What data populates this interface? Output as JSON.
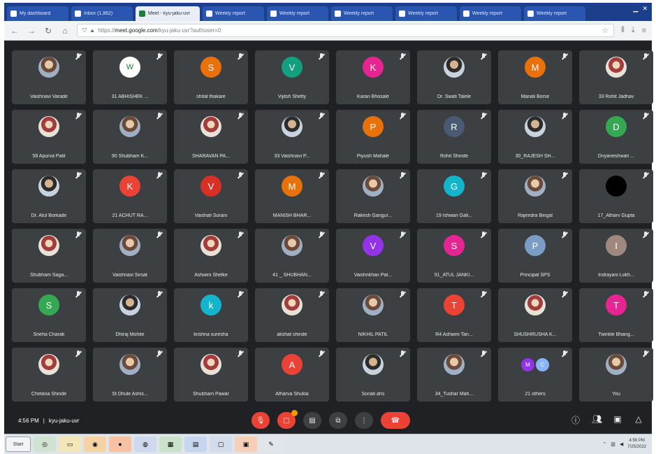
{
  "browser": {
    "tabs": [
      {
        "label": "My dashboard",
        "active": false
      },
      {
        "label": "Inbox (1,862)",
        "active": false
      },
      {
        "label": "Meet - kyu-jaku-uvr",
        "active": true
      },
      {
        "label": "Weekly report",
        "active": false
      },
      {
        "label": "Weekly report",
        "active": false
      },
      {
        "label": "Weekly report",
        "active": false
      },
      {
        "label": "Weekly report",
        "active": false
      },
      {
        "label": "Weekly report",
        "active": false
      },
      {
        "label": "Weekly report",
        "active": false
      }
    ],
    "url_domain": "meet.google.com",
    "url_rest": "/kyu-jaku-uvr?authuser=0",
    "url_prefix": "https://"
  },
  "participants": [
    {
      "name": "Vaishnavi Varade",
      "initial": "",
      "color": "",
      "kind": "photo"
    },
    {
      "name": "31 ABHISHEK ...",
      "initial": "W",
      "color": "#ffffff",
      "kind": "logo"
    },
    {
      "name": "shital thakare",
      "initial": "S",
      "color": "#e8710a",
      "kind": "initial"
    },
    {
      "name": "Vijitsh Shetty",
      "initial": "V",
      "color": "#12a07f",
      "kind": "initial"
    },
    {
      "name": "Karan Bhosale",
      "initial": "K",
      "color": "#e52592",
      "kind": "initial"
    },
    {
      "name": "Dr. Swati Talele",
      "initial": "",
      "color": "",
      "kind": "photo2"
    },
    {
      "name": "Manali Borse",
      "initial": "M",
      "color": "#e8710a",
      "kind": "initial"
    },
    {
      "name": "33 Rohit Jadhav",
      "initial": "",
      "color": "",
      "kind": "photo3"
    },
    {
      "name": "58 Apurva Patil",
      "initial": "",
      "color": "",
      "kind": "photo3"
    },
    {
      "name": "90 Shubham K...",
      "initial": "",
      "color": "",
      "kind": "photo"
    },
    {
      "name": "SHARAVAN PA...",
      "initial": "",
      "color": "",
      "kind": "photo3"
    },
    {
      "name": "33 Vaishnavi P...",
      "initial": "",
      "color": "",
      "kind": "photo2"
    },
    {
      "name": "Piyush Mahale",
      "initial": "P",
      "color": "#e8710a",
      "kind": "initial"
    },
    {
      "name": "Rohit Shinde",
      "initial": "R",
      "color": "#4b5a73",
      "kind": "initial"
    },
    {
      "name": "30_RAJESH SH...",
      "initial": "",
      "color": "",
      "kind": "photo2"
    },
    {
      "name": "Dnyaneshwari ...",
      "initial": "D",
      "color": "#34a853",
      "kind": "initial"
    },
    {
      "name": "Dr. Atul Borkade",
      "initial": "",
      "color": "",
      "kind": "photo2"
    },
    {
      "name": "21 ACHUT RA...",
      "initial": "K",
      "color": "#ea4335",
      "kind": "initial"
    },
    {
      "name": "Vaishali Surani",
      "initial": "V",
      "color": "#d93025",
      "kind": "initial"
    },
    {
      "name": "MANISH BHAR...",
      "initial": "M",
      "color": "#e8710a",
      "kind": "initial"
    },
    {
      "name": "Rakesh Gangur...",
      "initial": "",
      "color": "",
      "kind": "photo"
    },
    {
      "name": "19 Ishwari Gali...",
      "initial": "G",
      "color": "#12b5cb",
      "kind": "initial"
    },
    {
      "name": "Rajendra Bingal",
      "initial": "",
      "color": "",
      "kind": "photo"
    },
    {
      "name": "17_Atharv Gupta",
      "initial": "",
      "color": "",
      "kind": "dark"
    },
    {
      "name": "Shubham Sagа...",
      "initial": "",
      "color": "",
      "kind": "photo3"
    },
    {
      "name": "Vaishnavi Sirsat",
      "initial": "",
      "color": "",
      "kind": "photo"
    },
    {
      "name": "Ashwini Shelke",
      "initial": "",
      "color": "",
      "kind": "photo3"
    },
    {
      "name": "41 _ SHUBHAN...",
      "initial": "",
      "color": "",
      "kind": "photo"
    },
    {
      "name": "Vaishnkhan Pat...",
      "initial": "V",
      "color": "#9334e6",
      "kind": "initial"
    },
    {
      "name": "51_ATUL JANKI...",
      "initial": "S",
      "color": "#e52592",
      "kind": "initial"
    },
    {
      "name": "Principal SPS",
      "initial": "P",
      "color": "#7b9cc4",
      "kind": "initial"
    },
    {
      "name": "Indrayani Lokh...",
      "initial": "I",
      "color": "#a1887f",
      "kind": "initial"
    },
    {
      "name": "Sneha Charak",
      "initial": "S",
      "color": "#34a853",
      "kind": "initial"
    },
    {
      "name": "Dhiraj Mohite",
      "initial": "",
      "color": "",
      "kind": "photo2"
    },
    {
      "name": "krishna suresha",
      "initial": "k",
      "color": "#12b5cb",
      "kind": "initial"
    },
    {
      "name": "akshat shinde",
      "initial": "",
      "color": "",
      "kind": "photo3"
    },
    {
      "name": "NIKHIL PATIL",
      "initial": "",
      "color": "",
      "kind": "photo"
    },
    {
      "name": "R4 Ashwini Tan...",
      "initial": "T",
      "color": "#ea4335",
      "kind": "initial"
    },
    {
      "name": "SHUSHRUSHA K...",
      "initial": "",
      "color": "",
      "kind": "photo3"
    },
    {
      "name": "Twinkle Bhang...",
      "initial": "T",
      "color": "#e52592",
      "kind": "initial"
    },
    {
      "name": "Chetana Shinde",
      "initial": "",
      "color": "",
      "kind": "photo3"
    },
    {
      "name": "St Dhule Ashis...",
      "initial": "",
      "color": "",
      "kind": "photo"
    },
    {
      "name": "Shubham Pawar",
      "initial": "",
      "color": "",
      "kind": "photo3"
    },
    {
      "name": "Atharva Shukla",
      "initial": "A",
      "color": "#ea4335",
      "kind": "initial"
    },
    {
      "name": "Sonali ahs",
      "initial": "",
      "color": "",
      "kind": "photo2"
    },
    {
      "name": "34_Tushar Mah...",
      "initial": "",
      "color": "",
      "kind": "photo"
    },
    {
      "name": "21 others",
      "initial": "MC",
      "color": "#9334e6",
      "kind": "duo"
    },
    {
      "name": "You",
      "initial": "",
      "color": "",
      "kind": "photo"
    }
  ],
  "meeting": {
    "time": "4:56 PM",
    "separator": "|",
    "code": "kyu-jaku-uvr"
  },
  "controls": {
    "mic_icon": "mic-off-icon",
    "camera_icon": "camera-off-icon",
    "captions_icon": "captions-icon",
    "present_icon": "present-screen-icon",
    "more_icon": "more-options-icon",
    "end_icon": "end-call-icon",
    "info_icon": "info-icon",
    "people_icon": "people-icon",
    "chat_icon": "chat-icon",
    "activities_icon": "activities-icon"
  },
  "taskbar": {
    "start_label": "Start",
    "time": "4:56 PM",
    "date": "7/25/2022"
  }
}
